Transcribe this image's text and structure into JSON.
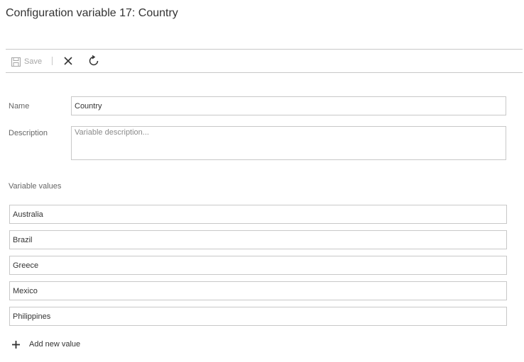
{
  "header": {
    "title": "Configuration variable 17: Country"
  },
  "toolbar": {
    "save_label": "Save",
    "icons": {
      "save": "save-disk-icon",
      "close": "close-x-icon",
      "refresh": "refresh-icon"
    }
  },
  "form": {
    "name_label": "Name",
    "name_value": "Country",
    "description_label": "Description",
    "description_value": "",
    "description_placeholder": "Variable description...",
    "values_label": "Variable values",
    "values": [
      "Australia",
      "Brazil",
      "Greece",
      "Mexico",
      "Philippines"
    ],
    "add_value_label": "Add new value"
  },
  "colors": {
    "border": "#c8c8c8",
    "text": "#333333",
    "muted_label": "#666666",
    "disabled": "#a6a6a6"
  }
}
